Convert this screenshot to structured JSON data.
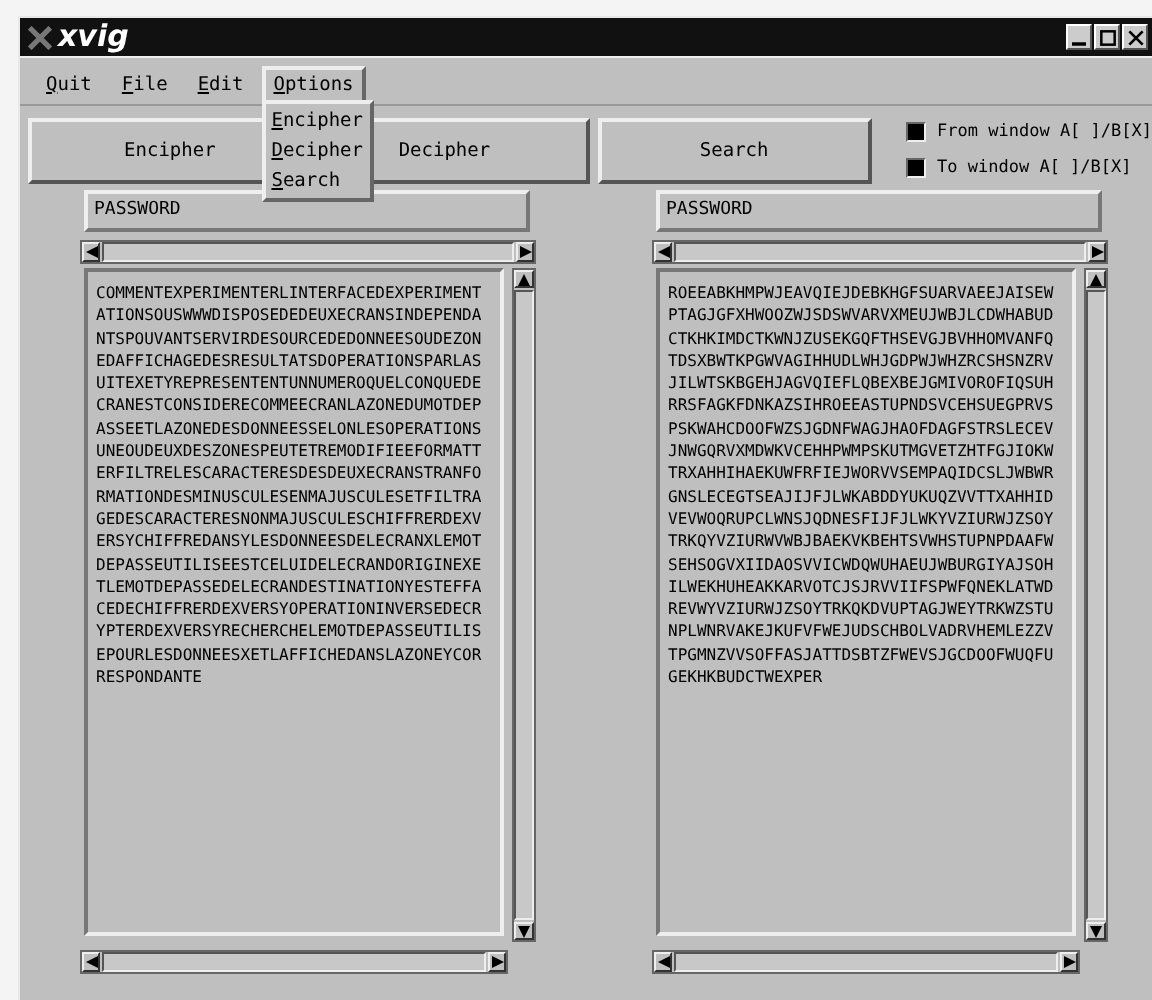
{
  "window": {
    "title": "xvig"
  },
  "menubar": [
    {
      "label": "Quit",
      "open": false
    },
    {
      "label": "File",
      "open": false
    },
    {
      "label": "Edit",
      "open": false
    },
    {
      "label": "Options",
      "open": true
    }
  ],
  "dropdown": [
    "Encipher",
    "Decipher",
    "Search"
  ],
  "buttons": [
    "Encipher",
    "Decipher",
    "Search"
  ],
  "toggles": [
    {
      "label": "From window A[ ]/B[X]",
      "checked": true
    },
    {
      "label": "To window A[ ]/B[X]",
      "checked": true
    }
  ],
  "panels": [
    {
      "password": "PASSWORD",
      "lines": [
        "COMMENTEXPERIMENTERLINTERFACEDEXPERIMENT",
        "ATIONSOUSWWWDISPOSEDEDEUXECRANSINDEPENDA",
        "NTSPOUVANTSERVIRDESOURCEDEDONNEESOUDEZON",
        "EDAFFICHAGEDESRESULTATSDOPERATIONSPARLAS",
        "UITEXETYREPRESENTENTUNNUMEROQUELCONQUEDE",
        "CRANESTCONSIDERECOMMEECRANLAZONEDUMOTDEP",
        "ASSEETLAZONEDESDONNEESSELONLESOPERATIONS",
        "UNEOUDEUXDESZONESPEUTETREMODIFIEEFORMATT",
        "ERFILTRELESCARACTERESDESDEUXECRANSTRANFO",
        "RMATIONDESMINUSCULESENMAJUSCULESETFILTRA",
        "GEDESCARACTERESNONMAJUSCULESCHIFFRERDEXV",
        "ERSYCHIFFREDANSYLESDONNEESDELECRANXLEMOT",
        "DEPASSEUTILISEESTCELUIDELECRANDORIGINEXE",
        "TLEMOTDEPASSEDELECRANDESTINATIONYESTEFFA",
        "CEDECHIFFRERDEXVERSYOPERATIONINVERSEDECR",
        "YPTERDEXVERSYRECHERCHELEMOTDEPASSEUTILIS",
        "EPOURLESDONNEESXETLAFFICHEDANSLAZONEYCOR",
        "RESPONDANTE"
      ]
    },
    {
      "password": "PASSWORD",
      "lines": [
        "ROEEABKHMPWJEAVQIEJDEBKHGFSUARVAEEJAISEW",
        "PTAGJGFXHWOOZWJSDSWVARVXMEUJWBJLCDWHABUD",
        "CTKHKIMDCTKWNJZUSEKGQFTHSEVGJBVHHOMVANFQ",
        "TDSXBWTKPGWVAGIHHUDLWHJGDPWJWHZRCSHSNZRV",
        "JILWTSKBGEHJAGVQIEFLQBEXBEJGMIVOROFIQSUH",
        "RRSFAGKFDNKAZSIHROEEASTUPNDSVCEHSUEGPRVS",
        "PSKWAHCDOOFWZSJGDNFWAGJHAOFDAGFSTRSLECEV",
        "JNWGQRVXMDWKVCEHHPWMPSKUTMGVETZHTFGJIOKW",
        "TRXAHHIHAEKUWFRFIEJWORVVSEMPAQIDCSLJWBWR",
        "GNSLECEGTSEAJIJFJLWKABDDYUKUQZVVTTXAHHID",
        "VEVWOQRUPCLWNSJQDNESFIJFJLWKYVZIURWJZSOY",
        "TRKQYVZIURWVWBJBAEKVKBEHTSVWHSTUPNPDAAFW",
        "SEHSOGVXIIDAOSVVICWDQWUHAEUJWBURGIYAJSOH",
        "ILWEKHUHEAKKARVOTCJSJRVVIIFSPWFQNEKLATWD",
        "REVWYVZIURWJZSOYTRKQKDVUPTAGJWEYTRKWZSTU",
        "NPLWNRVAKEJKUFVFWEJUDSCHBOLVADRVHEMLEZZV",
        "TPGMNZVVSOFFASJATTDSBTZFWEVSJGCDOOFWUQFU",
        "GEKHKBUDCTWEXPER"
      ]
    }
  ]
}
